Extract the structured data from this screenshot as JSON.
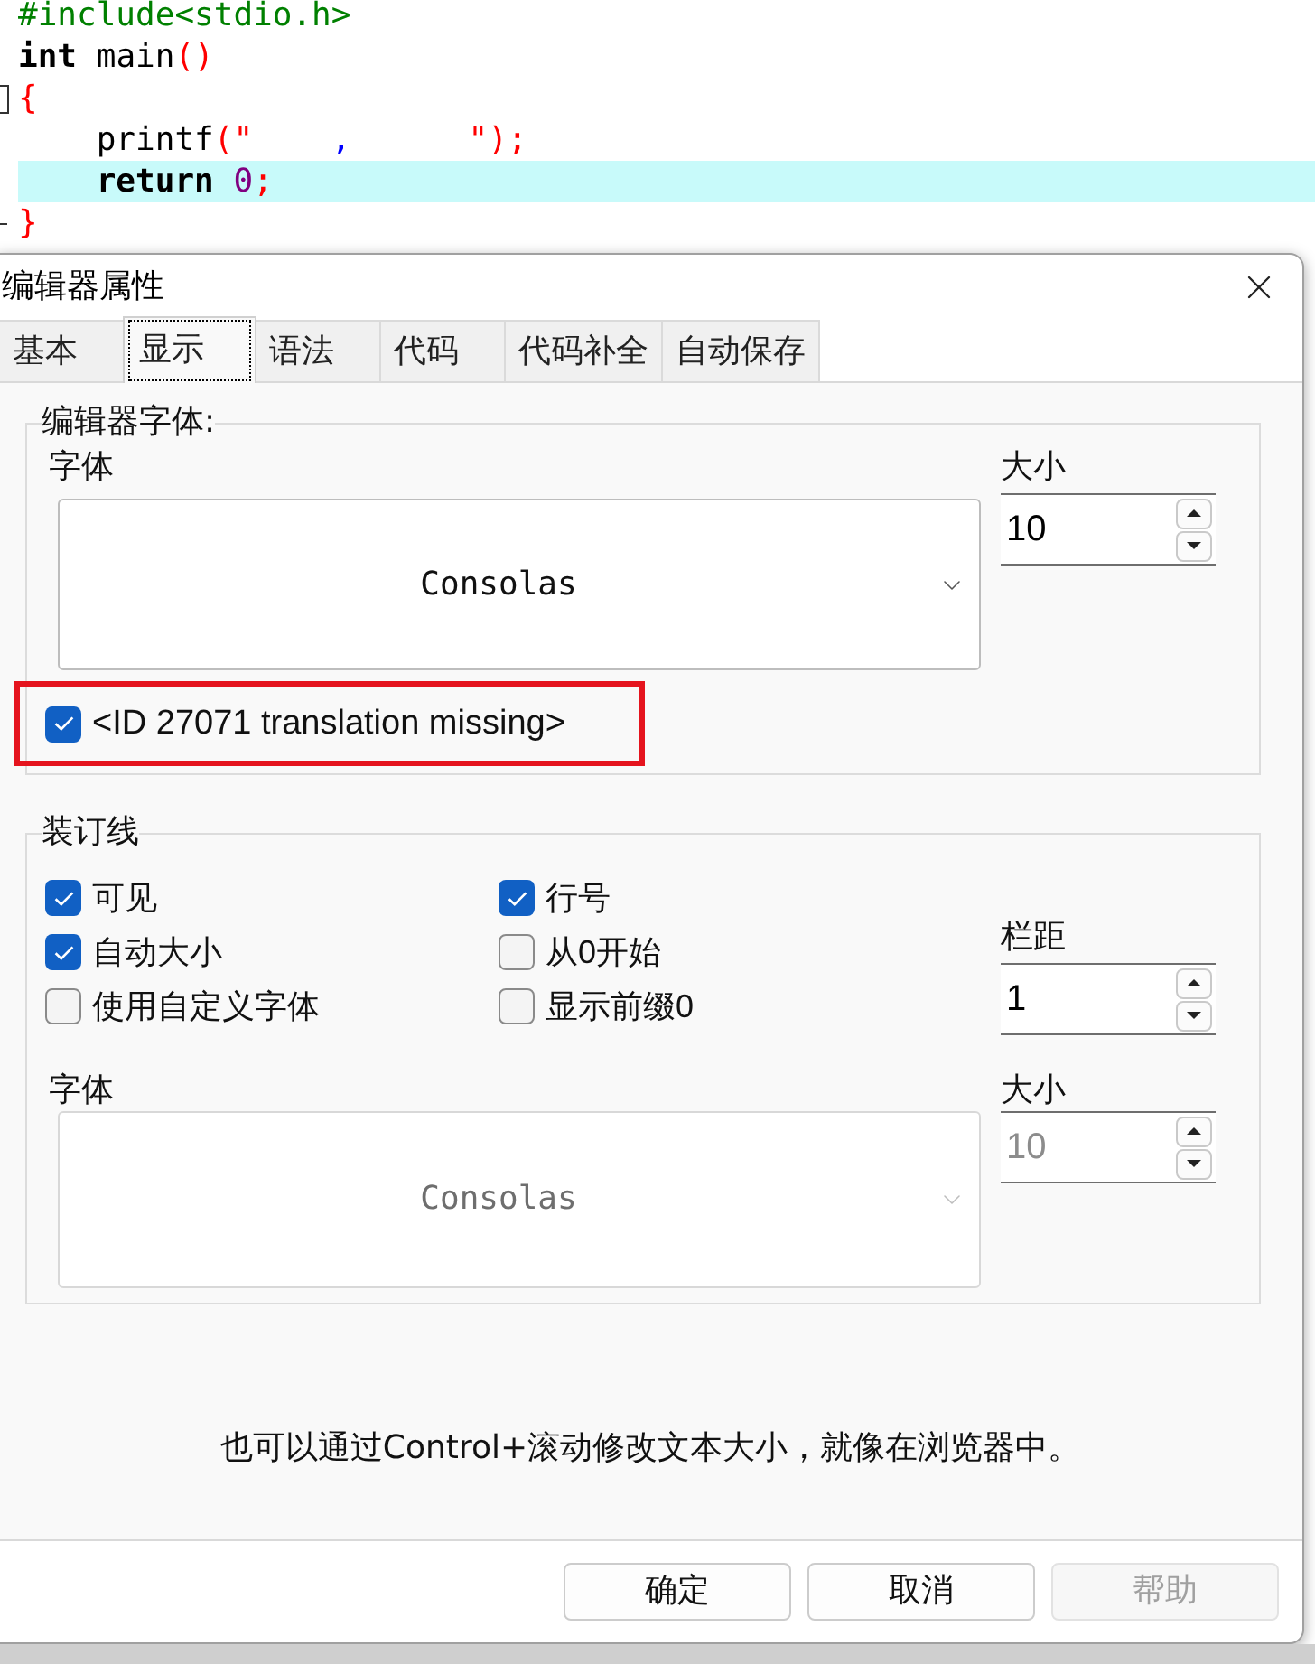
{
  "editor": {
    "lines": [
      {
        "tokens": [
          {
            "text": "#include<stdio.h>",
            "kind": "preprocessor"
          }
        ],
        "highlighted": false,
        "fold_start": false,
        "fold_end": false
      },
      {
        "tokens": [
          {
            "text": "int",
            "kind": "keyword"
          },
          {
            "text": " main",
            "kind": "plain"
          },
          {
            "text": "()",
            "kind": "symbol"
          }
        ],
        "highlighted": false,
        "fold_start": false,
        "fold_end": false
      },
      {
        "tokens": [
          {
            "text": "{",
            "kind": "symbol"
          }
        ],
        "highlighted": false,
        "fold_start": true,
        "fold_end": false
      },
      {
        "tokens": [
          {
            "text": "    printf",
            "kind": "plain"
          },
          {
            "text": "(\"",
            "kind": "symbol"
          },
          {
            "text": "    ,      ",
            "kind": "string"
          },
          {
            "text": "\");",
            "kind": "symbol"
          }
        ],
        "highlighted": false,
        "fold_start": false,
        "fold_end": false
      },
      {
        "tokens": [
          {
            "text": "    return ",
            "kind": "keyword"
          },
          {
            "text": "0",
            "kind": "number"
          },
          {
            "text": ";",
            "kind": "symbol"
          }
        ],
        "highlighted": true,
        "fold_start": false,
        "fold_end": false
      },
      {
        "tokens": [
          {
            "text": "}",
            "kind": "symbol"
          }
        ],
        "highlighted": false,
        "fold_start": false,
        "fold_end": true
      }
    ]
  },
  "dialog": {
    "title": "编辑器属性",
    "tabs": [
      {
        "label": "基本",
        "selected": false
      },
      {
        "label": "显示",
        "selected": true
      },
      {
        "label": "语法",
        "selected": false
      },
      {
        "label": "代码",
        "selected": false
      },
      {
        "label": "代码补全",
        "selected": false
      },
      {
        "label": "自动保存",
        "selected": false
      }
    ],
    "font_group": {
      "legend": "编辑器字体:",
      "font_label": "字体",
      "font": {
        "value": "Consolas",
        "disabled": false
      },
      "size_label": "大小",
      "size": {
        "value": "10",
        "disabled": false
      },
      "checkbox": {
        "label": "<ID 27071 translation missing>",
        "checked": true,
        "highlighted": true
      }
    },
    "gutter_group": {
      "legend": "装订线",
      "checkboxes": [
        {
          "label": "可见",
          "checked": true
        },
        {
          "label": "行号",
          "checked": true
        },
        {
          "label": "自动大小",
          "checked": true
        },
        {
          "label": "从0开始",
          "checked": false
        },
        {
          "label": "使用自定义字体",
          "checked": false
        },
        {
          "label": "显示前缀0",
          "checked": false
        }
      ],
      "padding_label": "栏距",
      "padding": {
        "value": "1",
        "disabled": false
      },
      "font_label": "字体",
      "font": {
        "value": "Consolas",
        "disabled": true
      },
      "size_label": "大小",
      "size": {
        "value": "10",
        "disabled": true
      }
    },
    "hint": "也可以通过Control+滚动修改文本大小，就像在浏览器中。",
    "buttons": [
      {
        "label": "确定",
        "disabled": false
      },
      {
        "label": "取消",
        "disabled": false
      },
      {
        "label": "帮助",
        "disabled": true
      }
    ]
  }
}
